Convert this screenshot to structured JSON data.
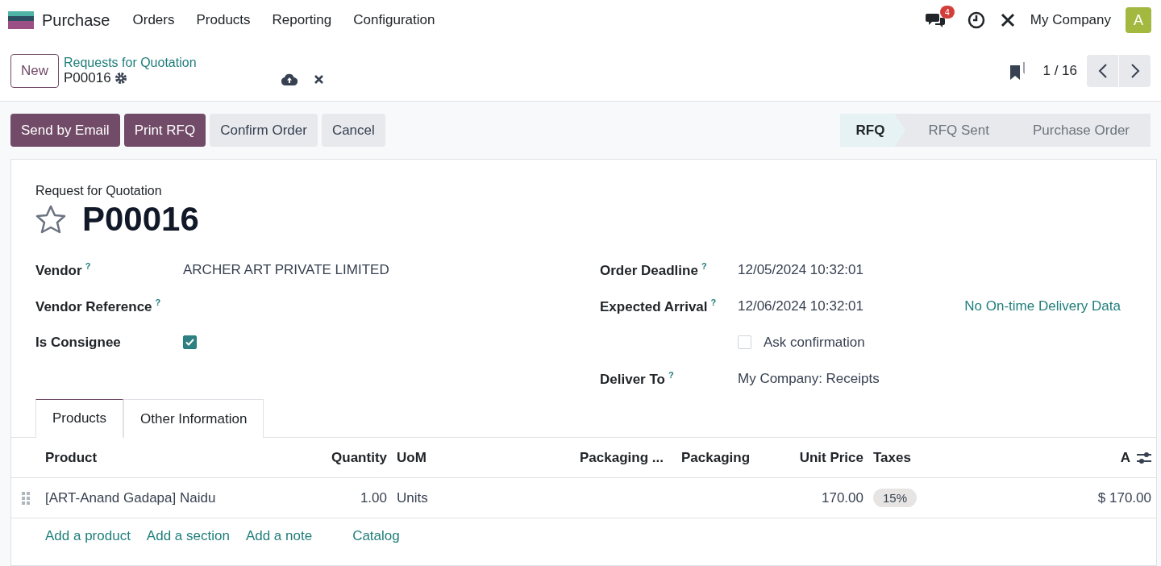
{
  "navbar": {
    "app": "Purchase",
    "menu": [
      "Orders",
      "Products",
      "Reporting",
      "Configuration"
    ],
    "messages_count": "4",
    "company": "My Company",
    "avatar": "A"
  },
  "control_panel": {
    "new_button": "New",
    "breadcrumb": "Requests for Quotation",
    "record": "P00016",
    "pager": "1 / 16"
  },
  "actions": [
    {
      "label": "Send by Email",
      "kind": "primary"
    },
    {
      "label": "Print RFQ",
      "kind": "primary"
    },
    {
      "label": "Confirm Order",
      "kind": "secondary"
    },
    {
      "label": "Cancel",
      "kind": "secondary"
    }
  ],
  "stages": [
    {
      "label": "RFQ",
      "selected": true
    },
    {
      "label": "RFQ Sent",
      "selected": false
    },
    {
      "label": "Purchase Order",
      "selected": false
    }
  ],
  "form": {
    "subtitle": "Request for Quotation",
    "title": "P00016",
    "starred": false,
    "left_fields": [
      {
        "kind": "text",
        "label": "Vendor",
        "help": "?",
        "value": "ARCHER ART PRIVATE LIMITED"
      },
      {
        "kind": "text",
        "label": "Vendor Reference",
        "help": "?"
      },
      {
        "kind": "checkbox",
        "label": "Is Consignee",
        "checked": true
      }
    ],
    "right_fields": [
      {
        "kind": "text",
        "label": "Order Deadline",
        "help": "?",
        "value": "12/05/2024 10:32:01"
      },
      {
        "kind": "text",
        "label": "Expected Arrival",
        "help": "?",
        "value": "12/06/2024 10:32:01",
        "link": "No On-time Delivery Data"
      },
      {
        "kind": "inline_checkbox",
        "label": "Ask confirmation",
        "checked": false
      },
      {
        "kind": "text",
        "label": "Deliver To",
        "help": "?",
        "value": "My Company: Receipts"
      }
    ]
  },
  "tabs": [
    {
      "label": "Products",
      "selected": true
    },
    {
      "label": "Other Information",
      "selected": false
    }
  ],
  "table": {
    "columns": [
      "Product",
      "Quantity",
      "UoM",
      "Packaging ...",
      "Packaging",
      "Unit Price",
      "Taxes",
      "A"
    ],
    "rows": [
      {
        "cells": [
          "[ART-Anand Gadapa] Naidu",
          "1.00",
          "Units",
          "",
          "",
          "170.00",
          "15%",
          "$ 170.00"
        ]
      }
    ],
    "add_links": [
      "Add a product",
      "Add a section",
      "Add a note"
    ],
    "catalog": "Catalog"
  }
}
